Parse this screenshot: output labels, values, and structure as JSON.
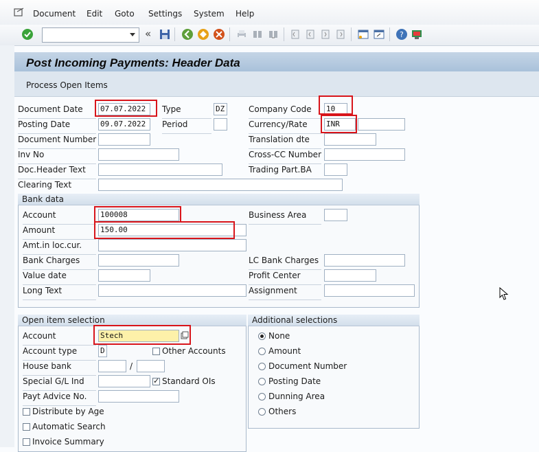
{
  "menu": [
    "Document",
    "Edit",
    "Goto",
    "Settings",
    "System",
    "Help"
  ],
  "toolbar": {
    "command_value": "",
    "icons": [
      "enter-icon",
      "dropdown-icon",
      "double-left-icon",
      "save-icon",
      "back-icon",
      "exit-icon",
      "cancel-icon",
      "print-icon",
      "find-icon",
      "find-next-icon",
      "first-page-icon",
      "prev-page-icon",
      "next-page-icon",
      "last-page-icon",
      "new-session-icon",
      "shortcut-icon",
      "help-icon",
      "customize-layout-icon"
    ]
  },
  "title": "Post Incoming Payments: Header Data",
  "app_toolbar": {
    "process_open_items": "Process Open Items"
  },
  "header": {
    "document_date": {
      "label": "Document Date",
      "value": "07.07.2022"
    },
    "type": {
      "label": "Type",
      "value": "DZ"
    },
    "company_code": {
      "label": "Company Code",
      "value": "10"
    },
    "posting_date": {
      "label": "Posting Date",
      "value": "09.07.2022"
    },
    "period": {
      "label": "Period",
      "value": ""
    },
    "currency_rate": {
      "label": "Currency/Rate",
      "value": "INR",
      "rate": ""
    },
    "document_number": {
      "label": "Document Number",
      "value": ""
    },
    "translation_dte": {
      "label": "Translation dte",
      "value": ""
    },
    "inv_no": {
      "label": "Inv No",
      "value": ""
    },
    "cross_cc_number": {
      "label": "Cross-CC Number",
      "value": ""
    },
    "doc_header_text": {
      "label": "Doc.Header Text",
      "value": ""
    },
    "trading_part_ba": {
      "label": "Trading Part.BA",
      "value": ""
    },
    "clearing_text": {
      "label": "Clearing Text",
      "value": ""
    }
  },
  "bank_data": {
    "title": "Bank data",
    "account": {
      "label": "Account",
      "value": "100008"
    },
    "business_area": {
      "label": "Business Area",
      "value": ""
    },
    "amount": {
      "label": "Amount",
      "value": "150.00"
    },
    "amt_loc_cur": {
      "label": "Amt.in loc.cur.",
      "value": ""
    },
    "bank_charges": {
      "label": "Bank Charges",
      "value": ""
    },
    "lc_bank_charges": {
      "label": "LC Bank Charges",
      "value": ""
    },
    "value_date": {
      "label": "Value date",
      "value": ""
    },
    "profit_center": {
      "label": "Profit Center",
      "value": ""
    },
    "long_text": {
      "label": "Long Text",
      "value": ""
    },
    "assignment": {
      "label": "Assignment",
      "value": ""
    }
  },
  "open_item_selection": {
    "title": "Open item selection",
    "account": {
      "label": "Account",
      "value": "Stech"
    },
    "account_type": {
      "label": "Account type",
      "value": "D"
    },
    "other_accounts": {
      "label": "Other Accounts",
      "checked": false
    },
    "house_bank": {
      "label": "House bank",
      "value": "",
      "separator": "/",
      "value2": ""
    },
    "special_gl": {
      "label": "Special G/L Ind",
      "value": ""
    },
    "standard_ois": {
      "label": "Standard OIs",
      "checked": true
    },
    "payt_advice": {
      "label": "Payt Advice No.",
      "value": ""
    },
    "distribute_by_age": {
      "label": "Distribute by Age",
      "checked": false
    },
    "automatic_search": {
      "label": "Automatic Search",
      "checked": false
    },
    "invoice_summary": {
      "label": "Invoice Summary",
      "checked": false
    }
  },
  "additional_selections": {
    "title": "Additional selections",
    "options": [
      "None",
      "Amount",
      "Document Number",
      "Posting Date",
      "Dunning Area",
      "Others"
    ],
    "selected": "None"
  }
}
